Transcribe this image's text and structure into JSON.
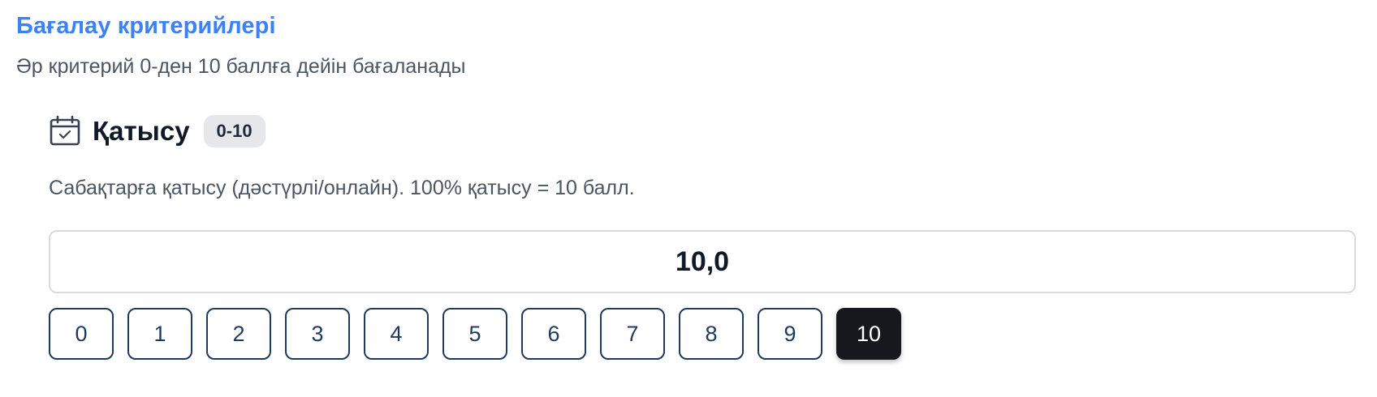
{
  "section": {
    "title": "Бағалау критерийлері",
    "subtitle": "Әр критерий 0-ден 10 баллға дейін бағаланады"
  },
  "criterion": {
    "icon": "calendar-check-icon",
    "name": "Қатысу",
    "range_badge": "0-10",
    "description": "Сабақтарға қатысу (дәстүрлі/онлайн). 100% қатысу = 10 балл.",
    "score_value": "10,0",
    "quick_scores": [
      "0",
      "1",
      "2",
      "3",
      "4",
      "5",
      "6",
      "7",
      "8",
      "9",
      "10"
    ],
    "selected_score": "10"
  },
  "colors": {
    "accent": "#3b82f6",
    "button_border": "#1e3a5f",
    "selected_bg": "#16181d"
  }
}
